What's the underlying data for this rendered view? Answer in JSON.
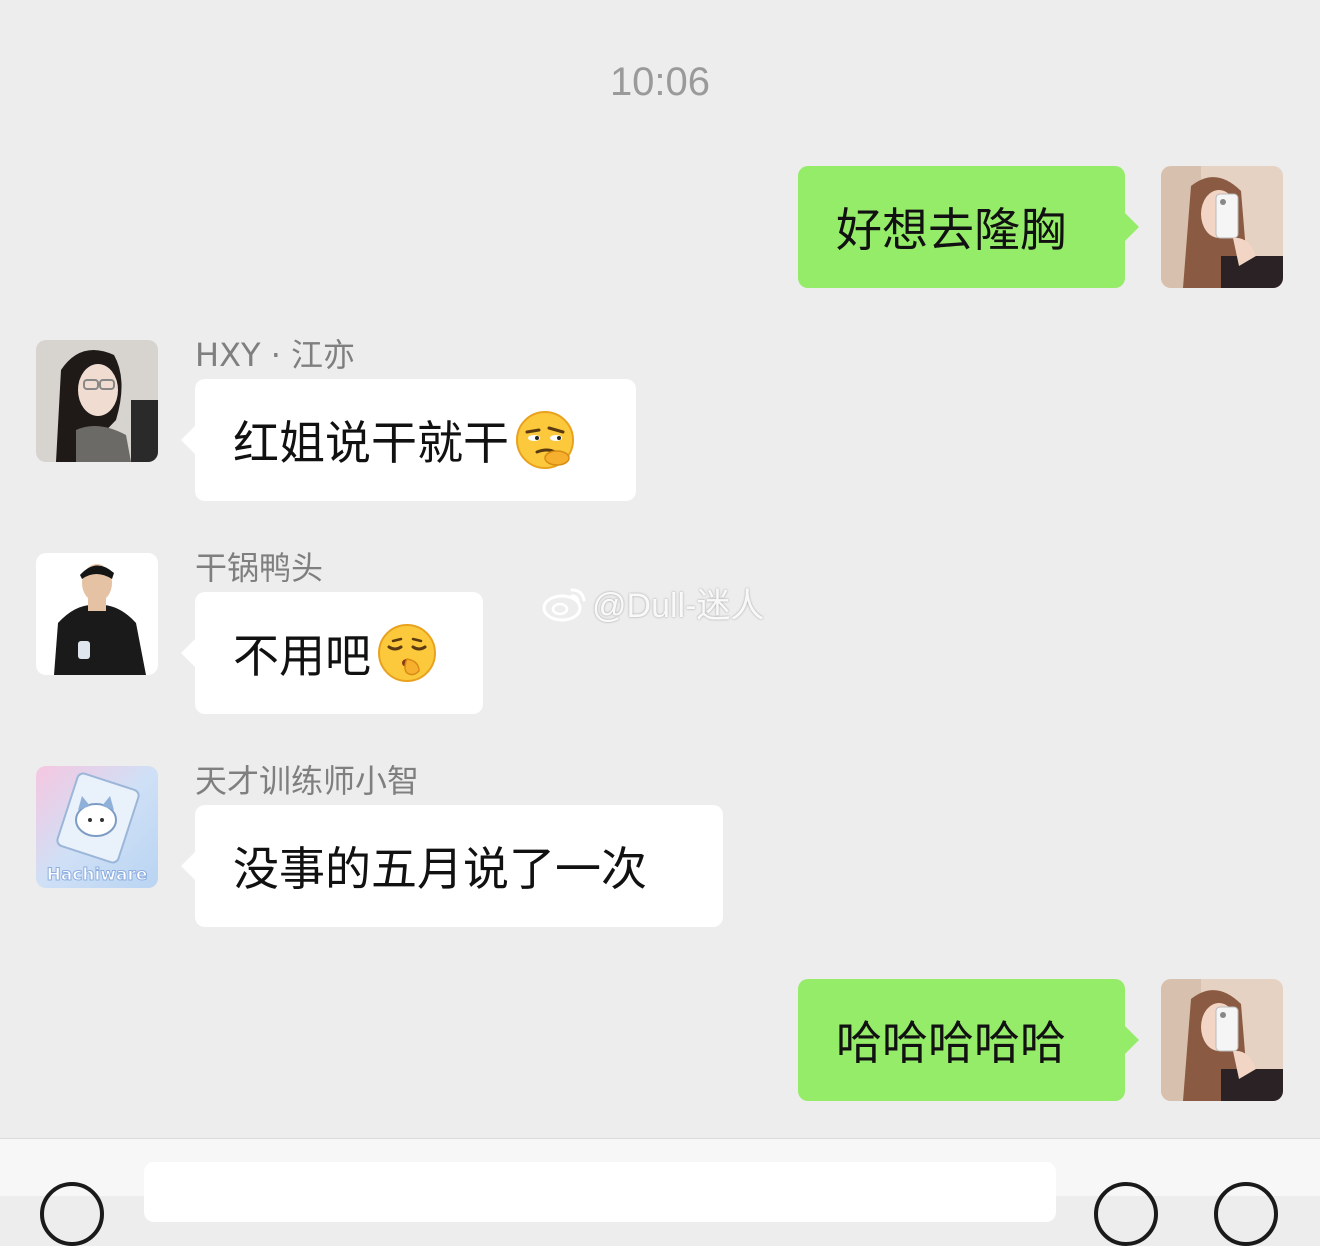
{
  "chat": {
    "timestamp": "10:06",
    "messages": [
      {
        "sender": "me",
        "text": "好想去隆胸"
      },
      {
        "sender": "HXY · 江亦",
        "text": "红姐说干就干",
        "emoji": "smirk-face"
      },
      {
        "sender": "干锅鸭头",
        "text": "不用吧",
        "emoji": "shushing-face"
      },
      {
        "sender": "天才训练师小智",
        "text": "没事的五月说了一次"
      },
      {
        "sender": "me",
        "text": "哈哈哈哈哈"
      }
    ],
    "avatar_text_hachiware": "Hachiware"
  },
  "watermark": {
    "text": "@Dull-迷人"
  },
  "colors": {
    "outgoing_bubble": "#95ec69",
    "incoming_bubble": "#ffffff",
    "background": "#ededed"
  }
}
